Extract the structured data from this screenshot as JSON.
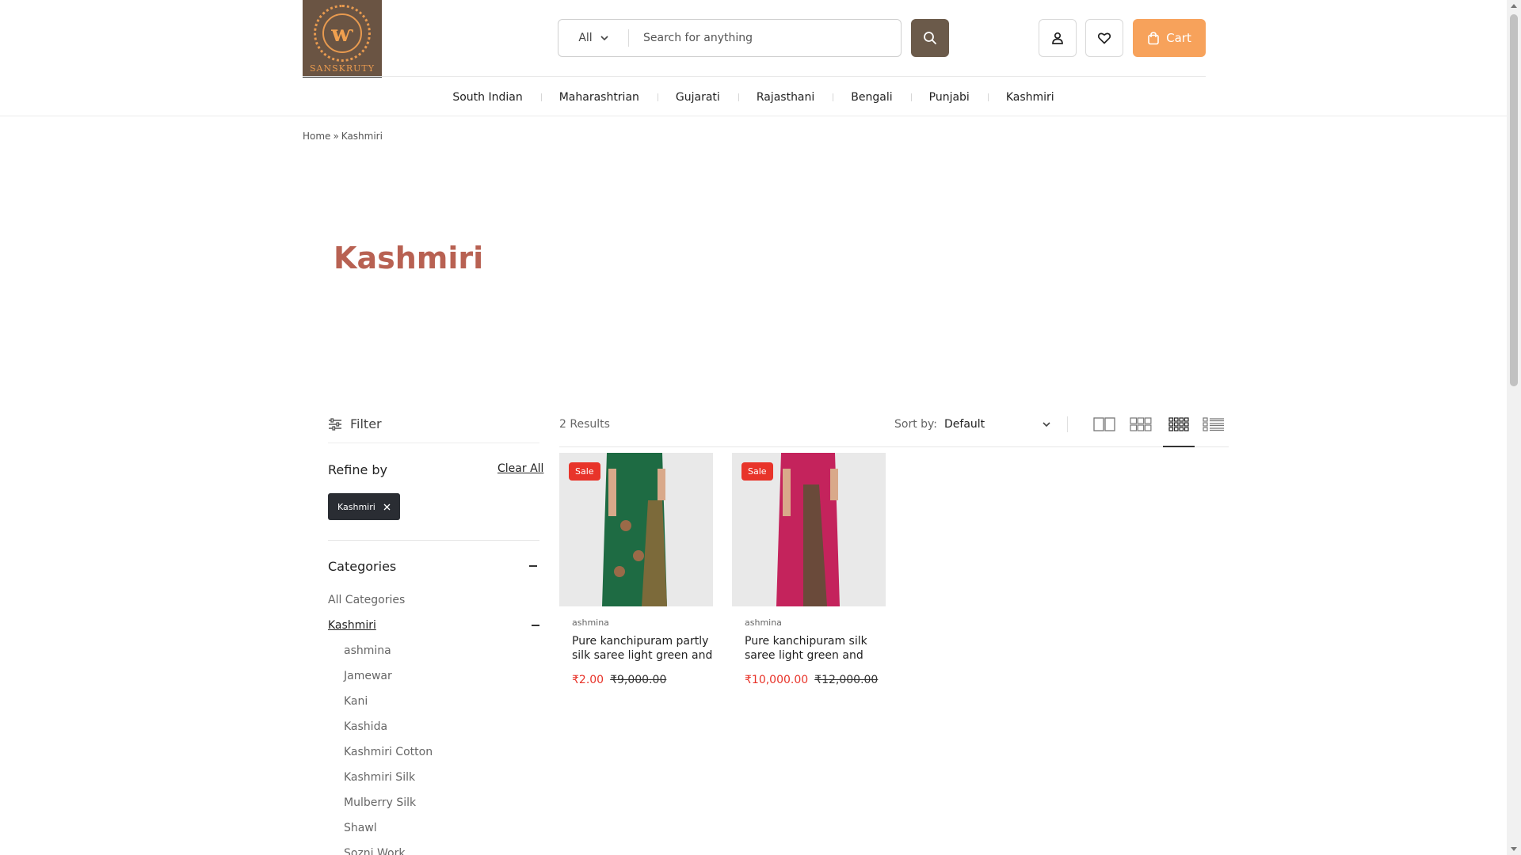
{
  "header": {
    "logo_text": "SANSKRUTY",
    "search_category": "All",
    "search_placeholder": "Search for anything",
    "cart_label": "Cart"
  },
  "nav": [
    "South Indian",
    "Maharashtrian",
    "Gujarati",
    "Rajasthani",
    "Bengali",
    "Punjabi",
    "Kashmiri"
  ],
  "breadcrumb": {
    "home": "Home",
    "separator": "»",
    "current": "Kashmiri"
  },
  "page_title": "Kashmiri",
  "sidebar": {
    "filter_label": "Filter",
    "refine_label": "Refine by",
    "clear_all": "Clear All",
    "active_filter": "Kashmiri",
    "categories_label": "Categories",
    "categories": [
      {
        "label": "All Categories",
        "level": 0,
        "active": false
      },
      {
        "label": "Kashmiri",
        "level": 0,
        "active": true
      },
      {
        "label": "ashmina",
        "level": 1
      },
      {
        "label": "Jamewar",
        "level": 1
      },
      {
        "label": "Kani",
        "level": 1
      },
      {
        "label": "Kashida",
        "level": 1
      },
      {
        "label": "Kashmiri Cotton",
        "level": 1
      },
      {
        "label": "Kashmiri Silk",
        "level": 1
      },
      {
        "label": "Mulberry Silk",
        "level": 1
      },
      {
        "label": "Shawl",
        "level": 1
      },
      {
        "label": "Sozni Work",
        "level": 1
      }
    ]
  },
  "toolbar": {
    "results": "2 Results",
    "sort_label": "Sort by:",
    "sort_value": "Default"
  },
  "products": [
    {
      "badge": "Sale",
      "brand": "ashmina",
      "title": "Pure kanchipuram partly silk saree light green and",
      "price": "₹2.00",
      "was_price": "₹9,000.00",
      "saree_color": "#1e6b43",
      "border_color": "#7c6a3a"
    },
    {
      "badge": "Sale",
      "brand": "ashmina",
      "title": "Pure kanchipuram silk saree light green and",
      "price": "₹10,000.00",
      "was_price": "₹12,000.00",
      "saree_color": "#c4235c",
      "border_color": "#6a4a3a"
    }
  ],
  "colors": {
    "accent_orange": "#f7a25b",
    "brown": "#6b5a4a",
    "title_red": "#b86152",
    "sale_red": "#e8342a"
  }
}
